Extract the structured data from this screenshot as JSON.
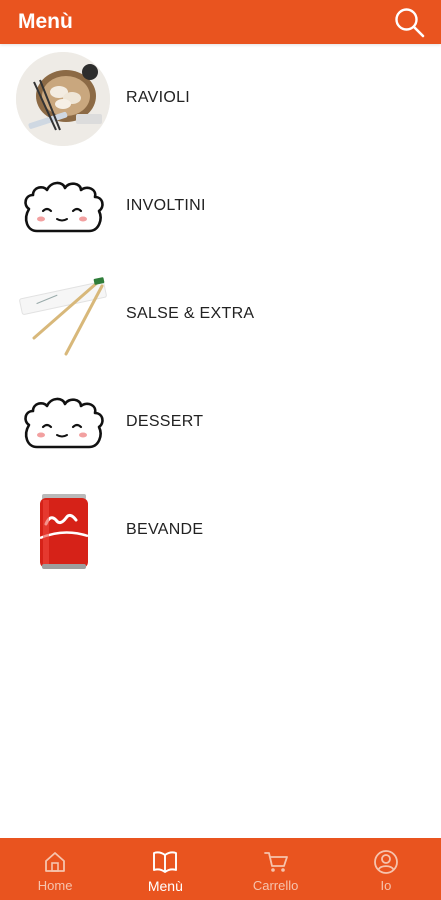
{
  "header": {
    "title": "Menù",
    "search_icon": "search-icon"
  },
  "categories": [
    {
      "label": "RAVIOLI",
      "image": "ravioli-photo"
    },
    {
      "label": "INVOLTINI",
      "image": "dumpling-mascot-icon"
    },
    {
      "label": "SALSE & EXTRA",
      "image": "chopsticks-photo"
    },
    {
      "label": "DESSERT",
      "image": "dumpling-mascot-icon"
    },
    {
      "label": "BEVANDE",
      "image": "soda-can-photo"
    }
  ],
  "tabs": [
    {
      "label": "Home",
      "icon": "home-icon",
      "active": false
    },
    {
      "label": "Menù",
      "icon": "book-icon",
      "active": true
    },
    {
      "label": "Carrello",
      "icon": "cart-icon",
      "active": false
    },
    {
      "label": "Io",
      "icon": "user-icon",
      "active": false
    }
  ],
  "colors": {
    "brand": "#e9541f",
    "tab_inactive": "#f6c3ad",
    "text": "#222222"
  }
}
